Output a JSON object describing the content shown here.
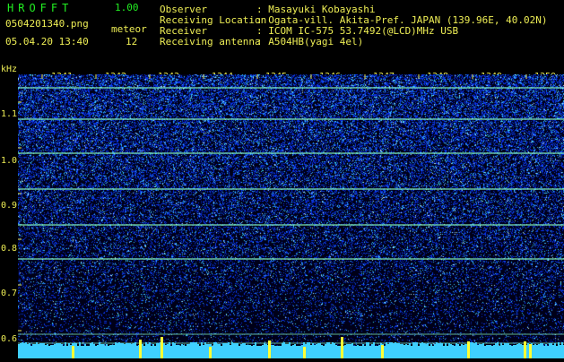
{
  "header": {
    "app_name": "HROFFT",
    "version": "1.00",
    "filename": "0504201340.png",
    "timestamp": "05.04.20 13:40",
    "meteor_label": "meteor",
    "meteor_count": "12"
  },
  "info": [
    {
      "key": "Observer",
      "value": ": Masayuki Kobayashi"
    },
    {
      "key": "Receiving Location",
      "value": ": Ogata-vill. Akita-Pref. JAPAN (139.96E, 40.02N)"
    },
    {
      "key": "Receiver",
      "value": ": ICOM IC-575 53.7492(@LCD)MHz USB"
    },
    {
      "key": "Receiving antenna",
      "value": ": A504HB(yagi 4el)"
    }
  ],
  "axis": {
    "y_unit": "kHz",
    "time_ticks": [
      "1341",
      "1342",
      "1343",
      "1344",
      "1345",
      "1346",
      "1347",
      "1348",
      "1349",
      "1350"
    ],
    "freq_ticks": [
      "1.1",
      "1.0",
      "0.9",
      "0.8",
      "0.7",
      "0.6"
    ]
  },
  "colors": {
    "label": "#eeee55",
    "title": "#22ee22",
    "noise_bg": "#000018",
    "noise_blue": "#1a3cff",
    "noise_cyan": "#3fd0ff",
    "carrier": "#8affc0",
    "meteor": "#ffff33"
  },
  "spectrogram": {
    "carrier_lines_khz": [
      1.131,
      1.063,
      0.988,
      0.91,
      0.832,
      0.757
    ],
    "meteor_minutes": [
      1340.05,
      1341.55,
      1342.8,
      1344.1,
      1345.2,
      1346.55,
      1347.3,
      1348.9,
      1349.95,
      1350.05,
      1343.2,
      1345.85
    ]
  }
}
